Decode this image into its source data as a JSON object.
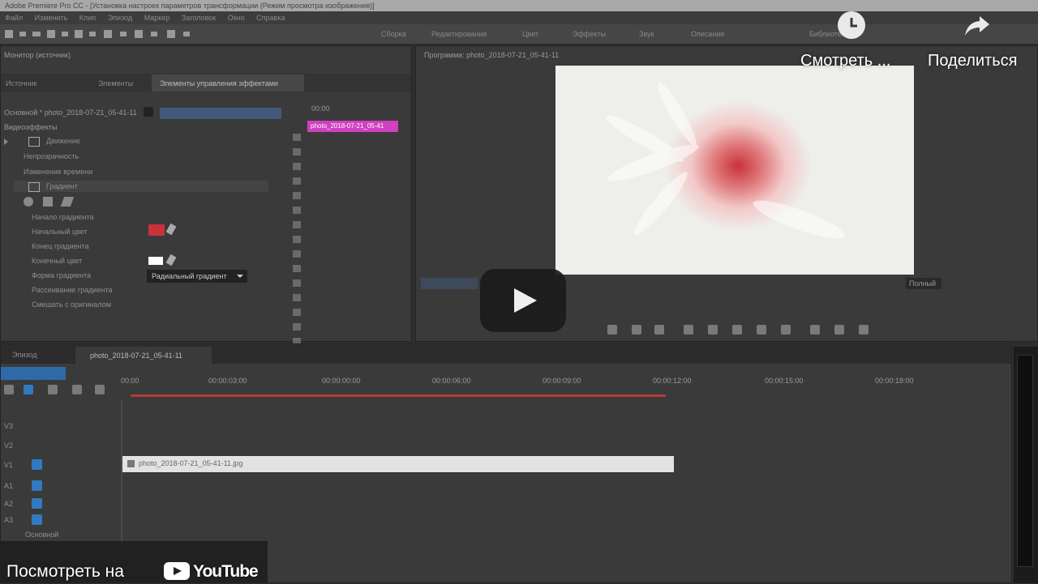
{
  "window": {
    "title": "Adobe Premiere Pro CC - [Установка настроек параметров трансформации (Режим просмотра изображения)]"
  },
  "menu": [
    "Файл",
    "Изменить",
    "Клип",
    "Эпизод",
    "Маркер",
    "Заголовок",
    "Окно",
    "Справка"
  ],
  "workspaces": [
    "Сборка",
    "Редактирование",
    "Цвет",
    "Эффекты",
    "Звук",
    "Описание",
    "Библиотеки"
  ],
  "effect_controls": {
    "panel_header": "Монитор (источник)",
    "tabs": [
      "Источник",
      "Элементы",
      "Элементы управления эффектами"
    ],
    "clip_path": "Основной * photo_2018-07-21_05-41-11",
    "section": "Видеоэффекты",
    "timeline_ruler_start": "00:00",
    "clip_label": "photo_2018-07-21_05-41",
    "effects": [
      {
        "label": "Движение",
        "has_fx": true
      },
      {
        "label": "Непрозрачность",
        "has_fx": false
      },
      {
        "label": "Изменение времени",
        "has_fx": false
      },
      {
        "label": "Градиент",
        "has_fx": true
      }
    ],
    "params": [
      {
        "label": "Начало градиента"
      },
      {
        "label": "Начальный цвет"
      },
      {
        "label": "Конец градиента"
      },
      {
        "label": "Конечный цвет"
      },
      {
        "label": "Форма градиента",
        "value": "Радиальный градиент"
      },
      {
        "label": "Рассеивание градиента"
      },
      {
        "label": "Смешать с оригиналом"
      }
    ],
    "start_color": "#c8323a",
    "end_color": "#ffffff"
  },
  "program_monitor": {
    "title": "Программа: photo_2018-07-21_05-41-11",
    "fit_label": "Полный"
  },
  "timeline": {
    "tab_left": "Эпизод",
    "sequence_tab": "photo_2018-07-21_05-41-11",
    "timecodes": [
      "00:00",
      "00:00:03:00",
      "00:00:00:00",
      "00:00:06:00",
      "00:00:09:00",
      "00:00:12:00",
      "00:00:15:00",
      "00:00:18:00"
    ],
    "clip_name": "photo_2018-07-21_05-41-11.jpg",
    "tracks": [
      "V3",
      "V2",
      "V1",
      "A1",
      "A2",
      "A3"
    ],
    "master": "Основной"
  },
  "overlay": {
    "watch_later": "Смотреть ...",
    "share": "Поделиться",
    "watch_on": "Посмотреть на",
    "brand": "YouTube"
  },
  "colors": {
    "accent_blue": "#2f7bc0",
    "clip_pink": "#d040c0",
    "playhead_red": "#b23a3a"
  }
}
